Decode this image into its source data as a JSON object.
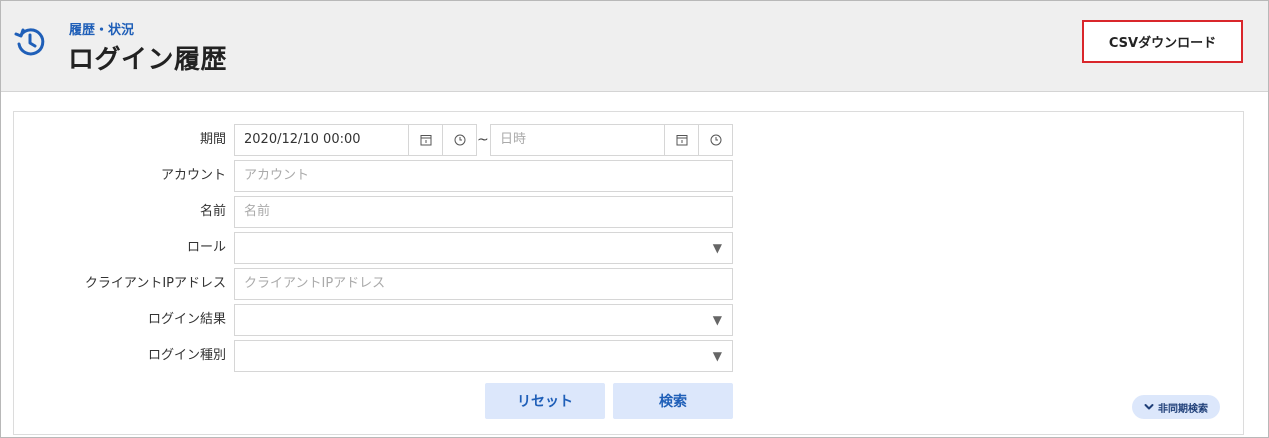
{
  "header": {
    "breadcrumb": "履歴・状況",
    "title": "ログイン履歴",
    "csv_button_label": "CSVダウンロード",
    "icon": "history-icon"
  },
  "form": {
    "period": {
      "label": "期間",
      "start_value": "2020/12/10 00:00",
      "separator": "~",
      "end_placeholder": "日時"
    },
    "account": {
      "label": "アカウント",
      "placeholder": "アカウント"
    },
    "name": {
      "label": "名前",
      "placeholder": "名前"
    },
    "role": {
      "label": "ロール",
      "value": ""
    },
    "client_ip": {
      "label": "クライアントIPアドレス",
      "placeholder": "クライアントIPアドレス"
    },
    "login_result": {
      "label": "ログイン結果",
      "value": ""
    },
    "login_type": {
      "label": "ログイン種別",
      "value": ""
    },
    "caret": "▼"
  },
  "actions": {
    "reset_label": "リセット",
    "search_label": "検索",
    "async_search_label": "非同期検索"
  },
  "colors": {
    "accent": "#1f5fb8",
    "csv_border": "#d9262b",
    "button_bg": "#dce7fb"
  }
}
